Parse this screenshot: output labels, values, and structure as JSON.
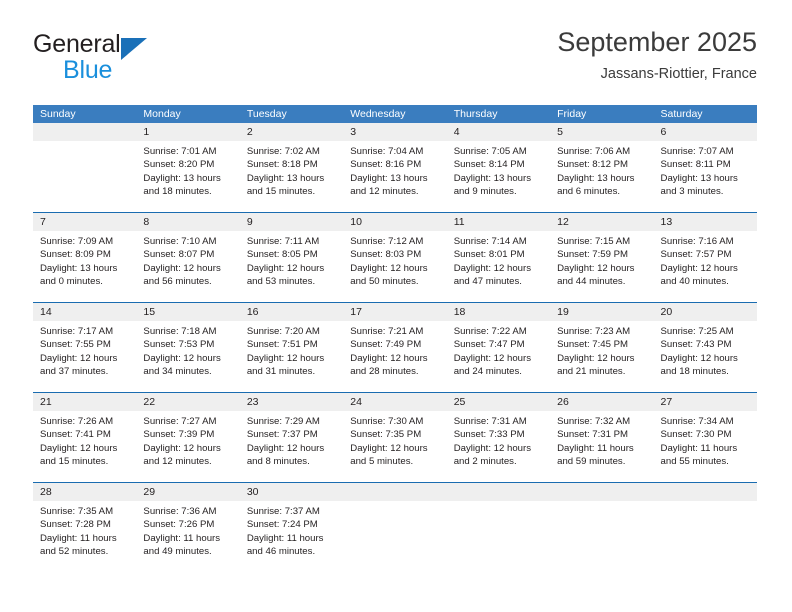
{
  "brand": {
    "word_one": "General",
    "word_two": "Blue",
    "logo_icon": "triangle-logo-icon",
    "accent_color": "#1a70b8",
    "blue_text_color": "#1a8fdc"
  },
  "header": {
    "title": "September 2025",
    "subtitle": "Jassans-Riottier, France"
  },
  "theme": {
    "header_row_bg": "#3a7dbf",
    "week_divider": "#1a6cb0",
    "daynum_band_bg": "#efefef"
  },
  "calendar": {
    "weekday_headers": [
      "Sunday",
      "Monday",
      "Tuesday",
      "Wednesday",
      "Thursday",
      "Friday",
      "Saturday"
    ],
    "weeks": [
      [
        {
          "day": "",
          "sunrise": "",
          "sunset": "",
          "daylight_line1": "",
          "daylight_line2": "",
          "empty": true
        },
        {
          "day": "1",
          "sunrise": "Sunrise: 7:01 AM",
          "sunset": "Sunset: 8:20 PM",
          "daylight_line1": "Daylight: 13 hours",
          "daylight_line2": "and 18 minutes."
        },
        {
          "day": "2",
          "sunrise": "Sunrise: 7:02 AM",
          "sunset": "Sunset: 8:18 PM",
          "daylight_line1": "Daylight: 13 hours",
          "daylight_line2": "and 15 minutes."
        },
        {
          "day": "3",
          "sunrise": "Sunrise: 7:04 AM",
          "sunset": "Sunset: 8:16 PM",
          "daylight_line1": "Daylight: 13 hours",
          "daylight_line2": "and 12 minutes."
        },
        {
          "day": "4",
          "sunrise": "Sunrise: 7:05 AM",
          "sunset": "Sunset: 8:14 PM",
          "daylight_line1": "Daylight: 13 hours",
          "daylight_line2": "and 9 minutes."
        },
        {
          "day": "5",
          "sunrise": "Sunrise: 7:06 AM",
          "sunset": "Sunset: 8:12 PM",
          "daylight_line1": "Daylight: 13 hours",
          "daylight_line2": "and 6 minutes."
        },
        {
          "day": "6",
          "sunrise": "Sunrise: 7:07 AM",
          "sunset": "Sunset: 8:11 PM",
          "daylight_line1": "Daylight: 13 hours",
          "daylight_line2": "and 3 minutes."
        }
      ],
      [
        {
          "day": "7",
          "sunrise": "Sunrise: 7:09 AM",
          "sunset": "Sunset: 8:09 PM",
          "daylight_line1": "Daylight: 13 hours",
          "daylight_line2": "and 0 minutes."
        },
        {
          "day": "8",
          "sunrise": "Sunrise: 7:10 AM",
          "sunset": "Sunset: 8:07 PM",
          "daylight_line1": "Daylight: 12 hours",
          "daylight_line2": "and 56 minutes."
        },
        {
          "day": "9",
          "sunrise": "Sunrise: 7:11 AM",
          "sunset": "Sunset: 8:05 PM",
          "daylight_line1": "Daylight: 12 hours",
          "daylight_line2": "and 53 minutes."
        },
        {
          "day": "10",
          "sunrise": "Sunrise: 7:12 AM",
          "sunset": "Sunset: 8:03 PM",
          "daylight_line1": "Daylight: 12 hours",
          "daylight_line2": "and 50 minutes."
        },
        {
          "day": "11",
          "sunrise": "Sunrise: 7:14 AM",
          "sunset": "Sunset: 8:01 PM",
          "daylight_line1": "Daylight: 12 hours",
          "daylight_line2": "and 47 minutes."
        },
        {
          "day": "12",
          "sunrise": "Sunrise: 7:15 AM",
          "sunset": "Sunset: 7:59 PM",
          "daylight_line1": "Daylight: 12 hours",
          "daylight_line2": "and 44 minutes."
        },
        {
          "day": "13",
          "sunrise": "Sunrise: 7:16 AM",
          "sunset": "Sunset: 7:57 PM",
          "daylight_line1": "Daylight: 12 hours",
          "daylight_line2": "and 40 minutes."
        }
      ],
      [
        {
          "day": "14",
          "sunrise": "Sunrise: 7:17 AM",
          "sunset": "Sunset: 7:55 PM",
          "daylight_line1": "Daylight: 12 hours",
          "daylight_line2": "and 37 minutes."
        },
        {
          "day": "15",
          "sunrise": "Sunrise: 7:18 AM",
          "sunset": "Sunset: 7:53 PM",
          "daylight_line1": "Daylight: 12 hours",
          "daylight_line2": "and 34 minutes."
        },
        {
          "day": "16",
          "sunrise": "Sunrise: 7:20 AM",
          "sunset": "Sunset: 7:51 PM",
          "daylight_line1": "Daylight: 12 hours",
          "daylight_line2": "and 31 minutes."
        },
        {
          "day": "17",
          "sunrise": "Sunrise: 7:21 AM",
          "sunset": "Sunset: 7:49 PM",
          "daylight_line1": "Daylight: 12 hours",
          "daylight_line2": "and 28 minutes."
        },
        {
          "day": "18",
          "sunrise": "Sunrise: 7:22 AM",
          "sunset": "Sunset: 7:47 PM",
          "daylight_line1": "Daylight: 12 hours",
          "daylight_line2": "and 24 minutes."
        },
        {
          "day": "19",
          "sunrise": "Sunrise: 7:23 AM",
          "sunset": "Sunset: 7:45 PM",
          "daylight_line1": "Daylight: 12 hours",
          "daylight_line2": "and 21 minutes."
        },
        {
          "day": "20",
          "sunrise": "Sunrise: 7:25 AM",
          "sunset": "Sunset: 7:43 PM",
          "daylight_line1": "Daylight: 12 hours",
          "daylight_line2": "and 18 minutes."
        }
      ],
      [
        {
          "day": "21",
          "sunrise": "Sunrise: 7:26 AM",
          "sunset": "Sunset: 7:41 PM",
          "daylight_line1": "Daylight: 12 hours",
          "daylight_line2": "and 15 minutes."
        },
        {
          "day": "22",
          "sunrise": "Sunrise: 7:27 AM",
          "sunset": "Sunset: 7:39 PM",
          "daylight_line1": "Daylight: 12 hours",
          "daylight_line2": "and 12 minutes."
        },
        {
          "day": "23",
          "sunrise": "Sunrise: 7:29 AM",
          "sunset": "Sunset: 7:37 PM",
          "daylight_line1": "Daylight: 12 hours",
          "daylight_line2": "and 8 minutes."
        },
        {
          "day": "24",
          "sunrise": "Sunrise: 7:30 AM",
          "sunset": "Sunset: 7:35 PM",
          "daylight_line1": "Daylight: 12 hours",
          "daylight_line2": "and 5 minutes."
        },
        {
          "day": "25",
          "sunrise": "Sunrise: 7:31 AM",
          "sunset": "Sunset: 7:33 PM",
          "daylight_line1": "Daylight: 12 hours",
          "daylight_line2": "and 2 minutes."
        },
        {
          "day": "26",
          "sunrise": "Sunrise: 7:32 AM",
          "sunset": "Sunset: 7:31 PM",
          "daylight_line1": "Daylight: 11 hours",
          "daylight_line2": "and 59 minutes."
        },
        {
          "day": "27",
          "sunrise": "Sunrise: 7:34 AM",
          "sunset": "Sunset: 7:30 PM",
          "daylight_line1": "Daylight: 11 hours",
          "daylight_line2": "and 55 minutes."
        }
      ],
      [
        {
          "day": "28",
          "sunrise": "Sunrise: 7:35 AM",
          "sunset": "Sunset: 7:28 PM",
          "daylight_line1": "Daylight: 11 hours",
          "daylight_line2": "and 52 minutes."
        },
        {
          "day": "29",
          "sunrise": "Sunrise: 7:36 AM",
          "sunset": "Sunset: 7:26 PM",
          "daylight_line1": "Daylight: 11 hours",
          "daylight_line2": "and 49 minutes."
        },
        {
          "day": "30",
          "sunrise": "Sunrise: 7:37 AM",
          "sunset": "Sunset: 7:24 PM",
          "daylight_line1": "Daylight: 11 hours",
          "daylight_line2": "and 46 minutes."
        },
        {
          "day": "",
          "sunrise": "",
          "sunset": "",
          "daylight_line1": "",
          "daylight_line2": "",
          "empty": true
        },
        {
          "day": "",
          "sunrise": "",
          "sunset": "",
          "daylight_line1": "",
          "daylight_line2": "",
          "empty": true
        },
        {
          "day": "",
          "sunrise": "",
          "sunset": "",
          "daylight_line1": "",
          "daylight_line2": "",
          "empty": true
        },
        {
          "day": "",
          "sunrise": "",
          "sunset": "",
          "daylight_line1": "",
          "daylight_line2": "",
          "empty": true
        }
      ]
    ]
  }
}
